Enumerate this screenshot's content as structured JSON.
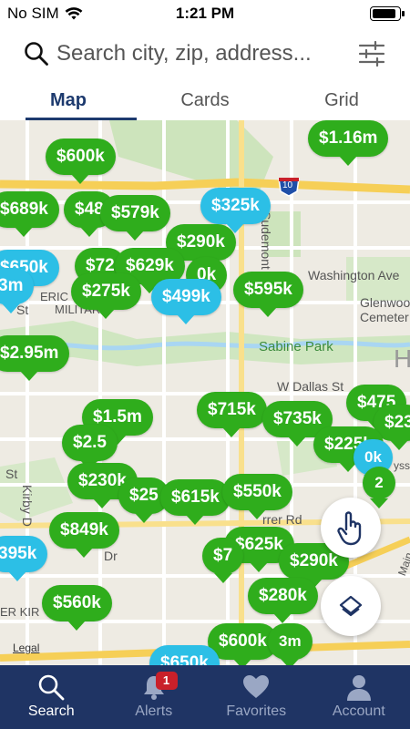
{
  "status": {
    "carrier": "No SIM",
    "time": "1:21 PM"
  },
  "search": {
    "placeholder": "Search city, zip, address..."
  },
  "view_tabs": [
    {
      "label": "Map",
      "active": true
    },
    {
      "label": "Cards",
      "active": false
    },
    {
      "label": "Grid",
      "active": false
    }
  ],
  "map": {
    "street_labels": {
      "washington": "Washington Ave",
      "sabine": "Sabine Park",
      "dallas": "W Dallas St",
      "glenwood": "Glenwood",
      "cemetery": "Cemeter",
      "sudemont": "Sudemont St",
      "military": "MILITAR",
      "eric": "ERIC",
      "kirby": "Kirby D",
      "st": "St",
      "dr": "Dr",
      "st2": "St",
      "rrer_rd": "rrer Rd",
      "kir": "ER KIR",
      "edge_h": "H",
      "ysst": "ysst",
      "maine": "Main",
      "interstate": "10"
    },
    "pins": [
      {
        "price": "$600k",
        "color": "green"
      },
      {
        "price": "$1.16m",
        "color": "green"
      },
      {
        "price": "$325k",
        "color": "blue"
      },
      {
        "price": "$689k",
        "color": "green"
      },
      {
        "price": "$48",
        "color": "green"
      },
      {
        "price": "$579k",
        "color": "green"
      },
      {
        "price": "$290k",
        "color": "green"
      },
      {
        "price": "$650k",
        "color": "blue"
      },
      {
        "price": "$72",
        "color": "green"
      },
      {
        "price": "$629k",
        "color": "green"
      },
      {
        "price": "0k",
        "color": "green"
      },
      {
        "price": "$275k",
        "color": "green"
      },
      {
        "price": "$499k",
        "color": "blue"
      },
      {
        "price": "$595k",
        "color": "green"
      },
      {
        "price": "3m",
        "color": "blue"
      },
      {
        "price": "$2.95m",
        "color": "green"
      },
      {
        "price": "$1.5m",
        "color": "green"
      },
      {
        "price": "$2.5",
        "color": "green"
      },
      {
        "price": "$715k",
        "color": "green"
      },
      {
        "price": "$735k",
        "color": "green"
      },
      {
        "price": "$475",
        "color": "green"
      },
      {
        "price": "$23",
        "color": "green"
      },
      {
        "price": "$225k",
        "color": "green"
      },
      {
        "price": "$230k",
        "color": "green"
      },
      {
        "price": "$25",
        "color": "green"
      },
      {
        "price": "$615k",
        "color": "green"
      },
      {
        "price": "$550k",
        "color": "green"
      },
      {
        "price": "$849k",
        "color": "green"
      },
      {
        "price": "$625k",
        "color": "green"
      },
      {
        "price": "$7",
        "color": "green"
      },
      {
        "price": "$290k",
        "color": "green"
      },
      {
        "price": "395k",
        "color": "blue"
      },
      {
        "price": "$560k",
        "color": "green"
      },
      {
        "price": "$280k",
        "color": "green"
      },
      {
        "price": "$600k",
        "color": "green"
      },
      {
        "price": "$650k",
        "color": "blue"
      },
      {
        "price": "0k",
        "color": "blue"
      },
      {
        "price": "3m",
        "color": "green"
      },
      {
        "price": "2",
        "color": "green"
      }
    ],
    "legal_label": "Legal"
  },
  "tabbar": [
    {
      "label": "Search",
      "icon": "search-icon",
      "active": true
    },
    {
      "label": "Alerts",
      "icon": "bell-icon",
      "badge": "1"
    },
    {
      "label": "Favorites",
      "icon": "heart-icon"
    },
    {
      "label": "Account",
      "icon": "person-icon"
    }
  ],
  "colors": {
    "accent": "#1d3a6e",
    "tabbar": "#1f3464",
    "pin_green": "#2fad1c",
    "pin_blue": "#2cbfe6",
    "badge": "#c9202a"
  }
}
